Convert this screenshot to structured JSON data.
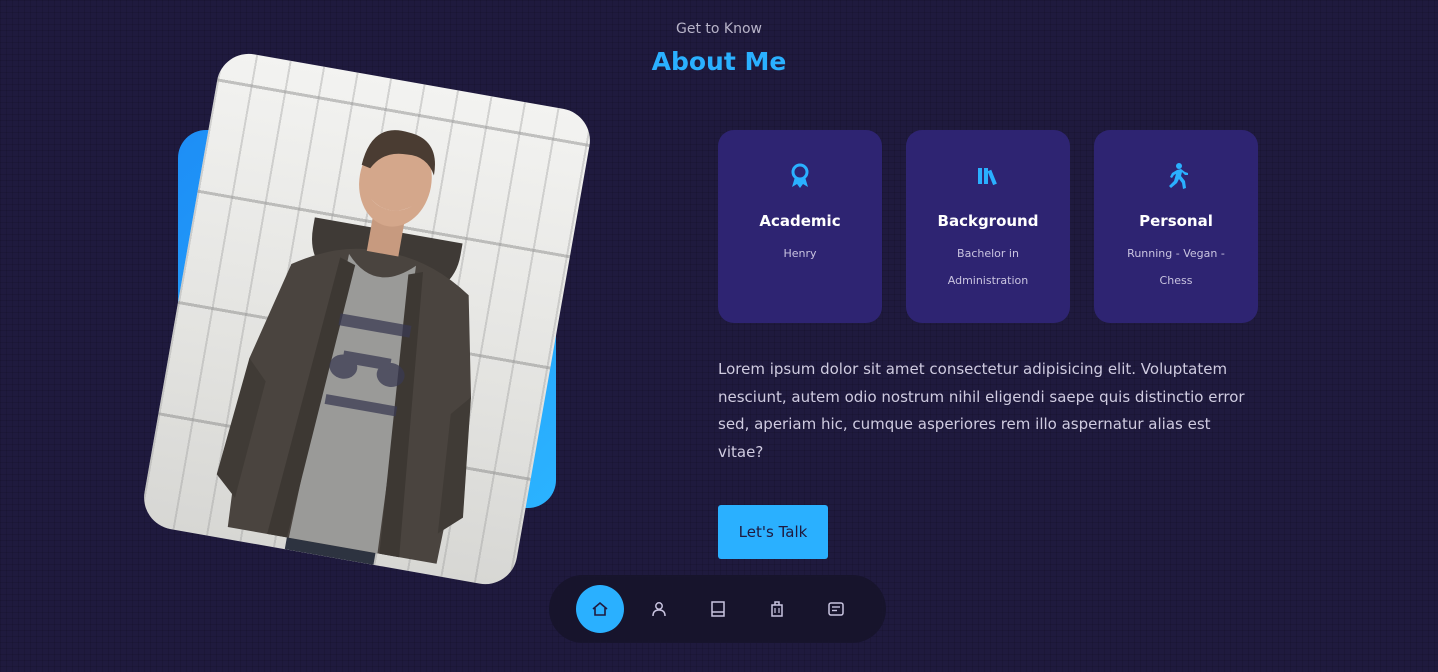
{
  "header": {
    "subtitle": "Get to Know",
    "title": "About Me"
  },
  "colors": {
    "accent": "#2ab0ff",
    "background": "#1f1a3e",
    "card": "#2e2472",
    "dock": "#17142c"
  },
  "cards": [
    {
      "icon": "award-icon",
      "title": "Academic",
      "text": "Henry"
    },
    {
      "icon": "books-icon",
      "title": "Background",
      "text": "Bachelor in Administration"
    },
    {
      "icon": "running-icon",
      "title": "Personal",
      "text": "Running - Vegan - Chess"
    }
  ],
  "bio": "Lorem ipsum dolor sit amet consectetur adipisicing elit. Voluptatem nesciunt, autem odio nostrum nihil eligendi saepe quis distinctio error sed, aperiam hic, cumque asperiores rem illo aspernatur alias est vitae?",
  "cta": {
    "label": "Let's Talk"
  },
  "nav": [
    {
      "icon": "home-icon",
      "active": true
    },
    {
      "icon": "user-icon",
      "active": false
    },
    {
      "icon": "book-icon",
      "active": false
    },
    {
      "icon": "briefcase-icon",
      "active": false
    },
    {
      "icon": "message-icon",
      "active": false
    }
  ]
}
